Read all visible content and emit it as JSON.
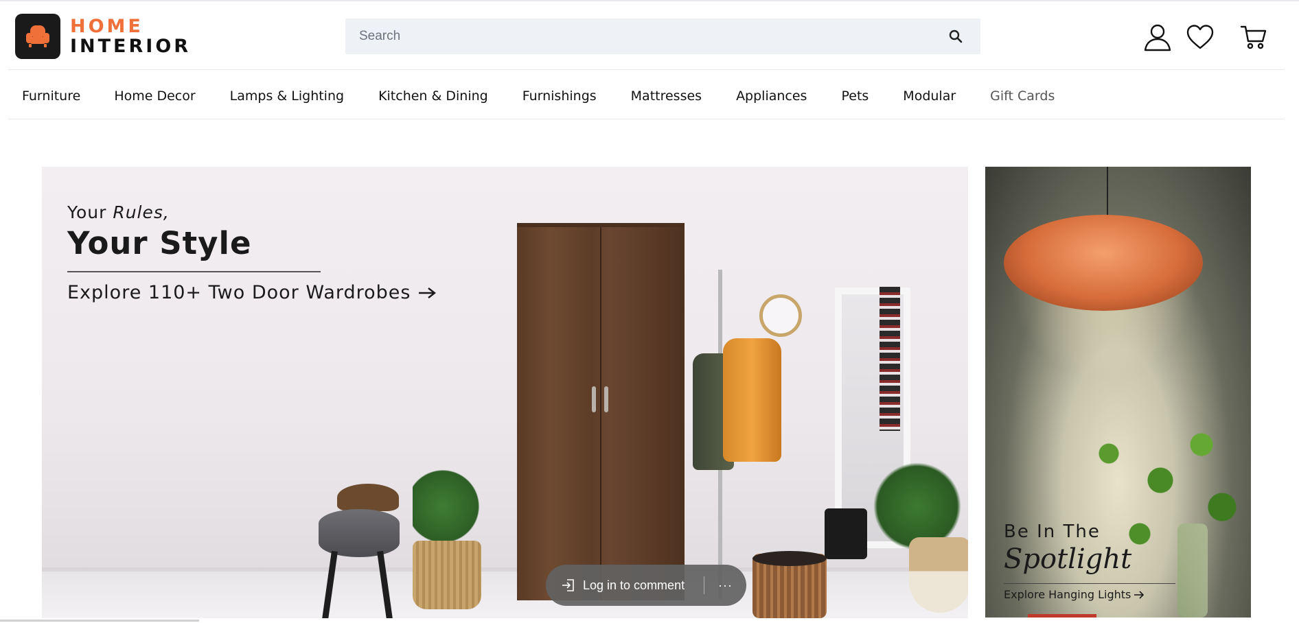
{
  "brand": {
    "name_line1": "HOME",
    "name_line2": "INTERIOR",
    "accent_color": "#F0703A",
    "logo_icon": "armchair-icon"
  },
  "search": {
    "placeholder": "Search",
    "value": "",
    "icon": "search-icon"
  },
  "header_icons": [
    {
      "name": "account-icon"
    },
    {
      "name": "wishlist-heart-icon"
    },
    {
      "name": "cart-icon"
    }
  ],
  "nav": {
    "items": [
      {
        "label": "Furniture"
      },
      {
        "label": "Home Decor"
      },
      {
        "label": "Lamps & Lighting"
      },
      {
        "label": "Kitchen & Dining"
      },
      {
        "label": "Furnishings"
      },
      {
        "label": "Mattresses"
      },
      {
        "label": "Appliances"
      },
      {
        "label": "Pets"
      },
      {
        "label": "Modular"
      },
      {
        "label": "Gift Cards"
      }
    ]
  },
  "hero": {
    "line1_plain": "Your ",
    "line1_italic": "Rules,",
    "line2": "Your Style",
    "cta": "Explore 110+ Two Door Wardrobes",
    "cta_icon": "arrow-right-icon"
  },
  "promo": {
    "title_line1": "Be In The",
    "title_line2": "Spotlight",
    "cta": "Explore Hanging Lights",
    "cta_icon": "arrow-right-icon"
  },
  "comment_bar": {
    "login_label": "Log in to comment",
    "login_icon": "sign-in-icon",
    "more_label": "···"
  }
}
